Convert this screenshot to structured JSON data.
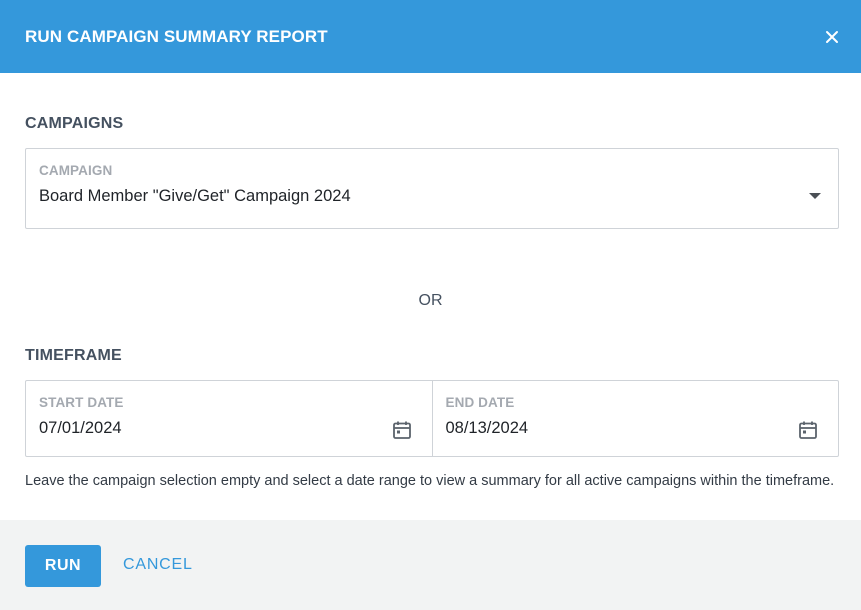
{
  "dialog": {
    "title": "RUN CAMPAIGN SUMMARY REPORT",
    "close_icon": "close-icon"
  },
  "campaigns": {
    "section_label": "CAMPAIGNS",
    "field_label": "CAMPAIGN",
    "selected_value": "Board Member \"Give/Get\" Campaign 2024"
  },
  "separator": "OR",
  "timeframe": {
    "section_label": "TIMEFRAME",
    "start_label": "START DATE",
    "start_value": "07/01/2024",
    "end_label": "END DATE",
    "end_value": "08/13/2024",
    "calendar_icon": "calendar-icon"
  },
  "help_text": "Leave the campaign selection empty and select a date range to view a summary for all active campaigns within the timeframe.",
  "footer": {
    "run_label": "RUN",
    "cancel_label": "CANCEL"
  },
  "colors": {
    "accent": "#3498db",
    "footer_bg": "#f2f3f3",
    "border": "#cfd3d8"
  }
}
